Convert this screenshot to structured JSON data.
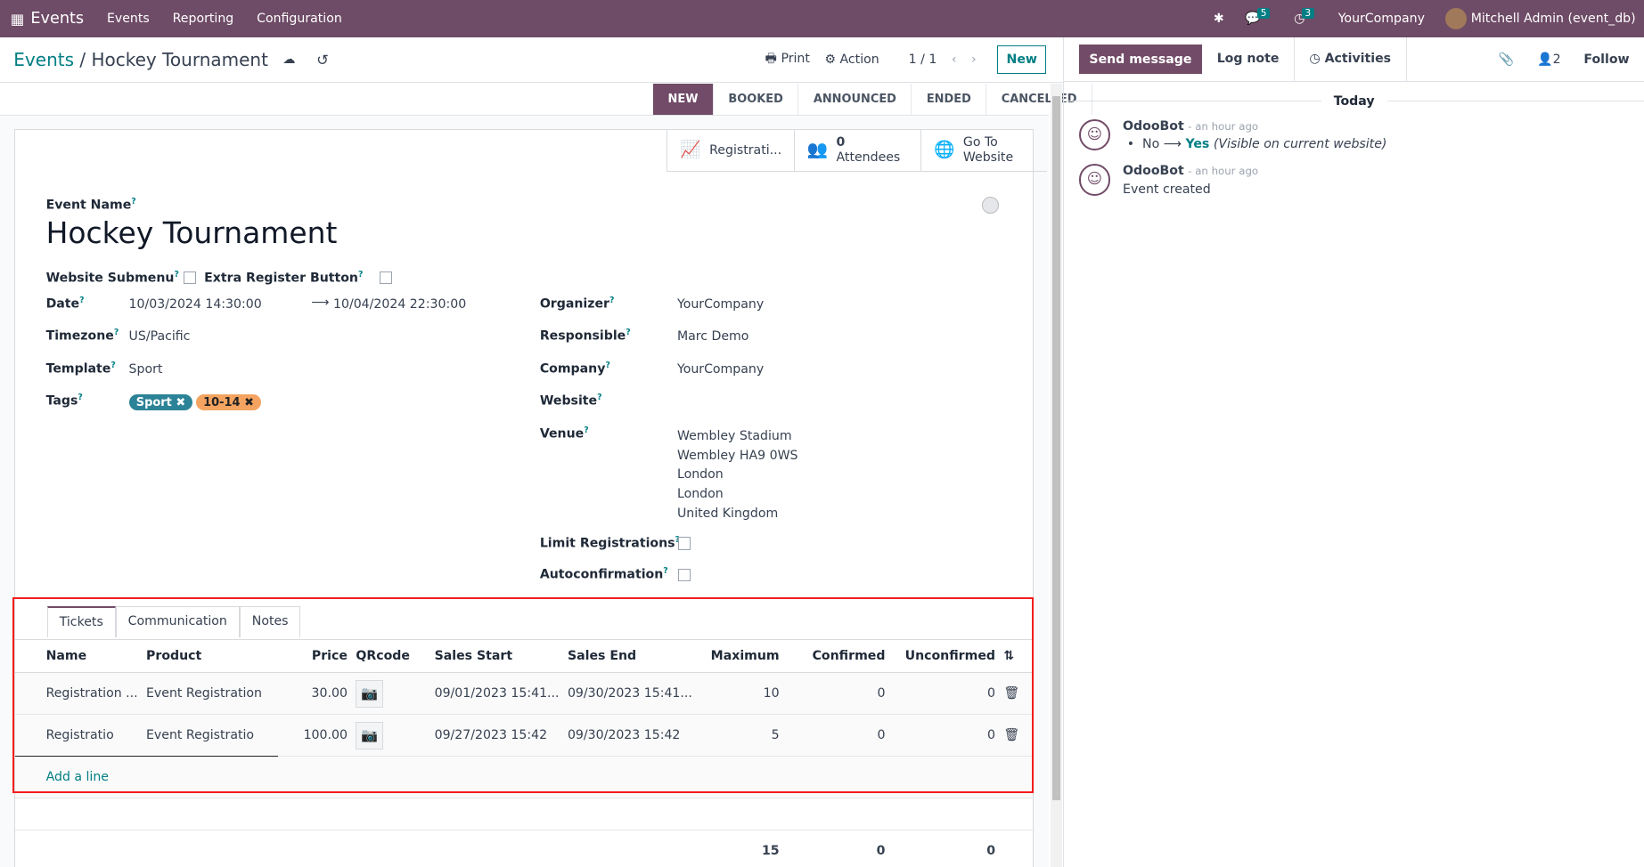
{
  "nav": {
    "app": "Events",
    "menu": [
      "Events",
      "Reporting",
      "Configuration"
    ],
    "messages_count": "5",
    "activities_count": "3",
    "company": "YourCompany",
    "user": "Mitchell Admin (event_db)"
  },
  "control": {
    "breadcrumb_root": "Events",
    "breadcrumb_current": "Hockey Tournament",
    "print": "Print",
    "action": "Action",
    "pager": "1 / 1",
    "new": "New"
  },
  "stages": [
    "NEW",
    "BOOKED",
    "ANNOUNCED",
    "ENDED",
    "CANCELLED"
  ],
  "smart_buttons": {
    "registrations": "Registrati...",
    "attendees_count": "0",
    "attendees": "Attendees",
    "website_1": "Go To",
    "website_2": "Website"
  },
  "form": {
    "event_name_label": "Event Name",
    "event_name": "Hockey Tournament",
    "website_submenu": "Website Submenu",
    "extra_register": "Extra Register Button",
    "date_label": "Date",
    "date_start": "10/03/2024 14:30:00",
    "date_end": "10/04/2024 22:30:00",
    "timezone_label": "Timezone",
    "timezone": "US/Pacific",
    "template_label": "Template",
    "template": "Sport",
    "tags_label": "Tags",
    "tags": [
      {
        "name": "Sport",
        "color": "#2c8397"
      },
      {
        "name": "10-14",
        "color": "#f4a460"
      }
    ],
    "organizer_label": "Organizer",
    "organizer": "YourCompany",
    "responsible_label": "Responsible",
    "responsible": "Marc Demo",
    "company_label": "Company",
    "company": "YourCompany",
    "website_label": "Website",
    "venue_label": "Venue",
    "venue": [
      "Wembley Stadium",
      "Wembley HA9 0WS",
      "London",
      "London",
      "United Kingdom"
    ],
    "limit_label": "Limit Registrations",
    "autoconf_label": "Autoconfirmation"
  },
  "tabs": [
    "Tickets",
    "Communication",
    "Notes"
  ],
  "tickets": {
    "columns": [
      "Name",
      "Product",
      "Price",
      "QRcode",
      "Sales Start",
      "Sales End",
      "Maximum",
      "Confirmed",
      "Unconfirmed"
    ],
    "rows": [
      [
        "Registration ...",
        "Event Registration",
        "30.00",
        "",
        "09/01/2023 15:41...",
        "09/30/2023 15:41...",
        "10",
        "0",
        "0"
      ],
      [
        "Registratio",
        "Event Registratio",
        "100.00",
        "",
        "09/27/2023 15:42",
        "09/30/2023 15:42",
        "5",
        "0",
        "0"
      ]
    ],
    "add_line": "Add a line",
    "totals": [
      "15",
      "0",
      "0"
    ]
  },
  "chatter": {
    "send": "Send message",
    "log": "Log note",
    "activities": "Activities",
    "followers": "2",
    "follow": "Follow",
    "today": "Today",
    "messages": [
      {
        "author": "OdooBot",
        "time": "- an hour ago",
        "old": "No",
        "new": "Yes",
        "note": "(Visible on current website)"
      },
      {
        "author": "OdooBot",
        "time": "- an hour ago",
        "body": "Event created"
      }
    ]
  }
}
